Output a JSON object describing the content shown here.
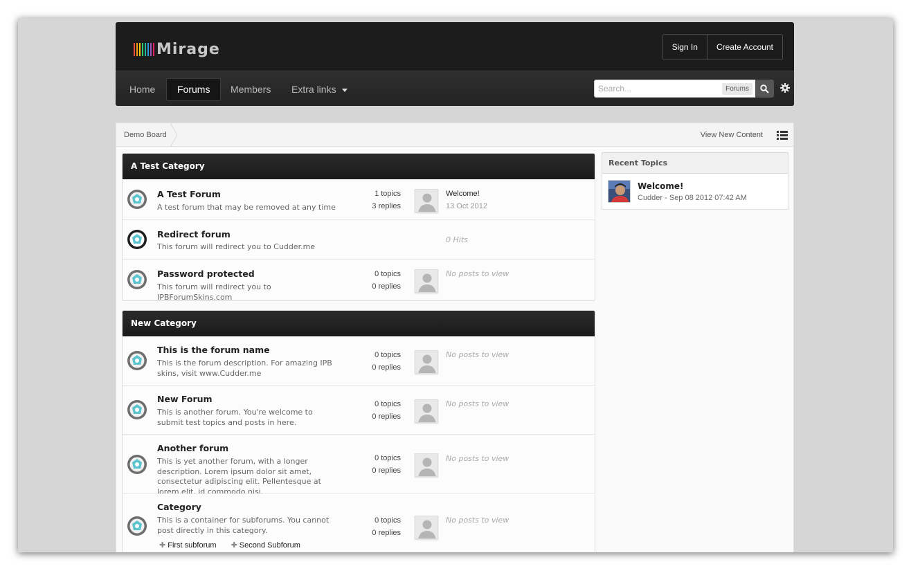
{
  "brand": {
    "name": "Mirage",
    "bar_colors": [
      "#e84c3d",
      "#f39c12",
      "#f1c40f",
      "#2ecc71",
      "#1abc9c",
      "#3498db",
      "#9b59b6",
      "#e91e63"
    ]
  },
  "auth": {
    "sign_in": "Sign In",
    "create_account": "Create Account"
  },
  "nav": {
    "items": [
      {
        "label": "Home"
      },
      {
        "label": "Forums"
      },
      {
        "label": "Members"
      },
      {
        "label": "Extra links"
      }
    ],
    "active": "Forums"
  },
  "search": {
    "placeholder": "Search...",
    "scope": "Forums"
  },
  "breadcrumb": {
    "root": "Demo Board",
    "view_new": "View New Content"
  },
  "categories": [
    {
      "name": "A Test Category",
      "forums": [
        {
          "title": "A Test Forum",
          "desc": "A test forum that may be removed at any time",
          "topics": "1 topics",
          "replies": "3 replies",
          "last_title": "Welcome!",
          "last_date": "13 Oct 2012"
        },
        {
          "title": "Redirect forum",
          "desc": "This forum will redirect you to Cudder.me",
          "hits": "0 Hits"
        },
        {
          "title": "Password protected",
          "desc": "This forum will redirect you to IPBForumSkins.com",
          "topics": "0 topics",
          "replies": "0 replies",
          "last_none": "No posts to view"
        }
      ]
    },
    {
      "name": "New Category",
      "forums": [
        {
          "title": "This is the forum name",
          "desc": "This is the forum description. For amazing IPB skins, visit www.Cudder.me",
          "topics": "0 topics",
          "replies": "0 replies",
          "last_none": "No posts to view"
        },
        {
          "title": "New Forum",
          "desc": "This is another forum. You're welcome to submit test topics and posts in here.",
          "topics": "0 topics",
          "replies": "0 replies",
          "last_none": "No posts to view"
        },
        {
          "title": "Another forum",
          "desc": "This is yet another forum, with a longer description. Lorem ipsum dolor sit amet, consectetur adipiscing elit. Pellentesque at lorem elit, id commodo nisi.",
          "topics": "0 topics",
          "replies": "0 replies",
          "last_none": "No posts to view"
        },
        {
          "title": "Category",
          "desc": "This is a container for subforums. You cannot post directly in this category.",
          "topics": "0 topics",
          "replies": "0 replies",
          "last_none": "No posts to view",
          "subforums": [
            "First subforum",
            "Second Subforum"
          ]
        }
      ]
    }
  ],
  "sidebar": {
    "title": "Recent Topics",
    "topic_title": "Welcome!",
    "topic_meta": "Cudder - Sep 08 2012 07:42 AM"
  }
}
